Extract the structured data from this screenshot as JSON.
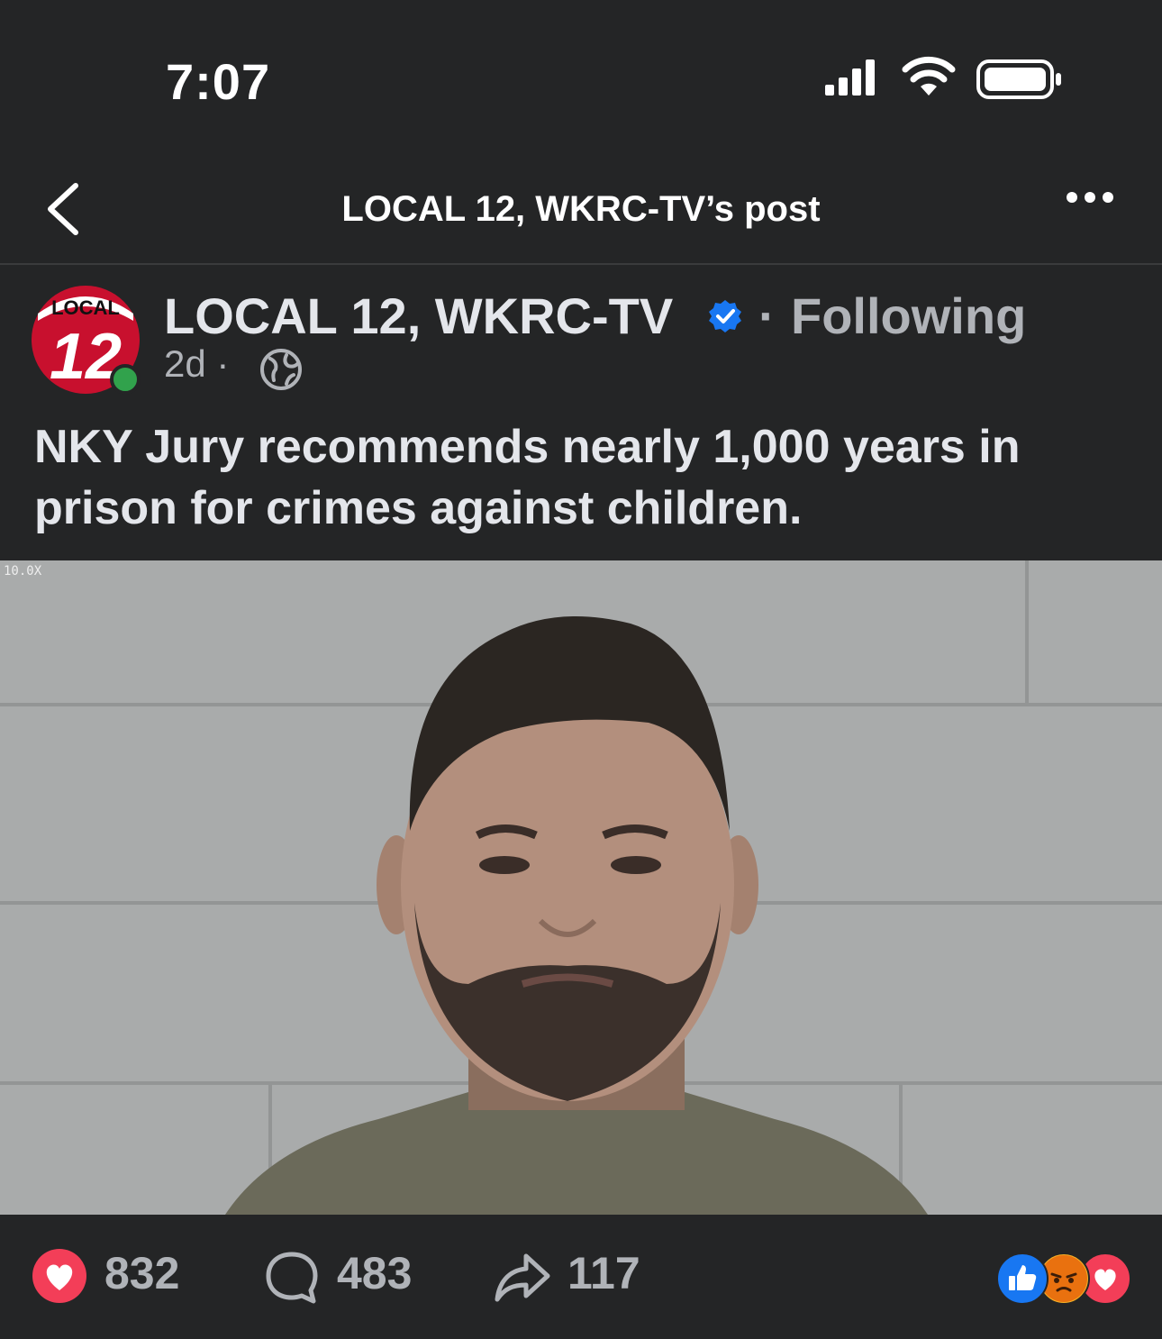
{
  "status": {
    "time": "7:07"
  },
  "nav": {
    "title": "LOCAL 12, WKRC-TV’s post"
  },
  "post": {
    "page_name": "LOCAL 12, WKRC-TV",
    "separator": "·",
    "following": "Following",
    "time_ago": "2d ·",
    "caption": "NKY Jury recommends nearly 1,000 years in prison for crimes against children.",
    "logo_text": "LOCAL",
    "logo_number": "12",
    "photo_overlay": "10.0X"
  },
  "stats": {
    "reactions": "832",
    "comments": "483",
    "shares": "117"
  },
  "colors": {
    "background": "#242526",
    "love": "#f33e58",
    "like": "#1877f2",
    "angry": "#f7b125",
    "online": "#31a24c"
  },
  "icons": [
    "back-chevron-icon",
    "more-dots-icon",
    "verified-badge-icon",
    "globe-icon",
    "heart-icon",
    "comment-icon",
    "share-icon",
    "like-reaction-icon",
    "angry-reaction-icon",
    "love-reaction-icon"
  ]
}
